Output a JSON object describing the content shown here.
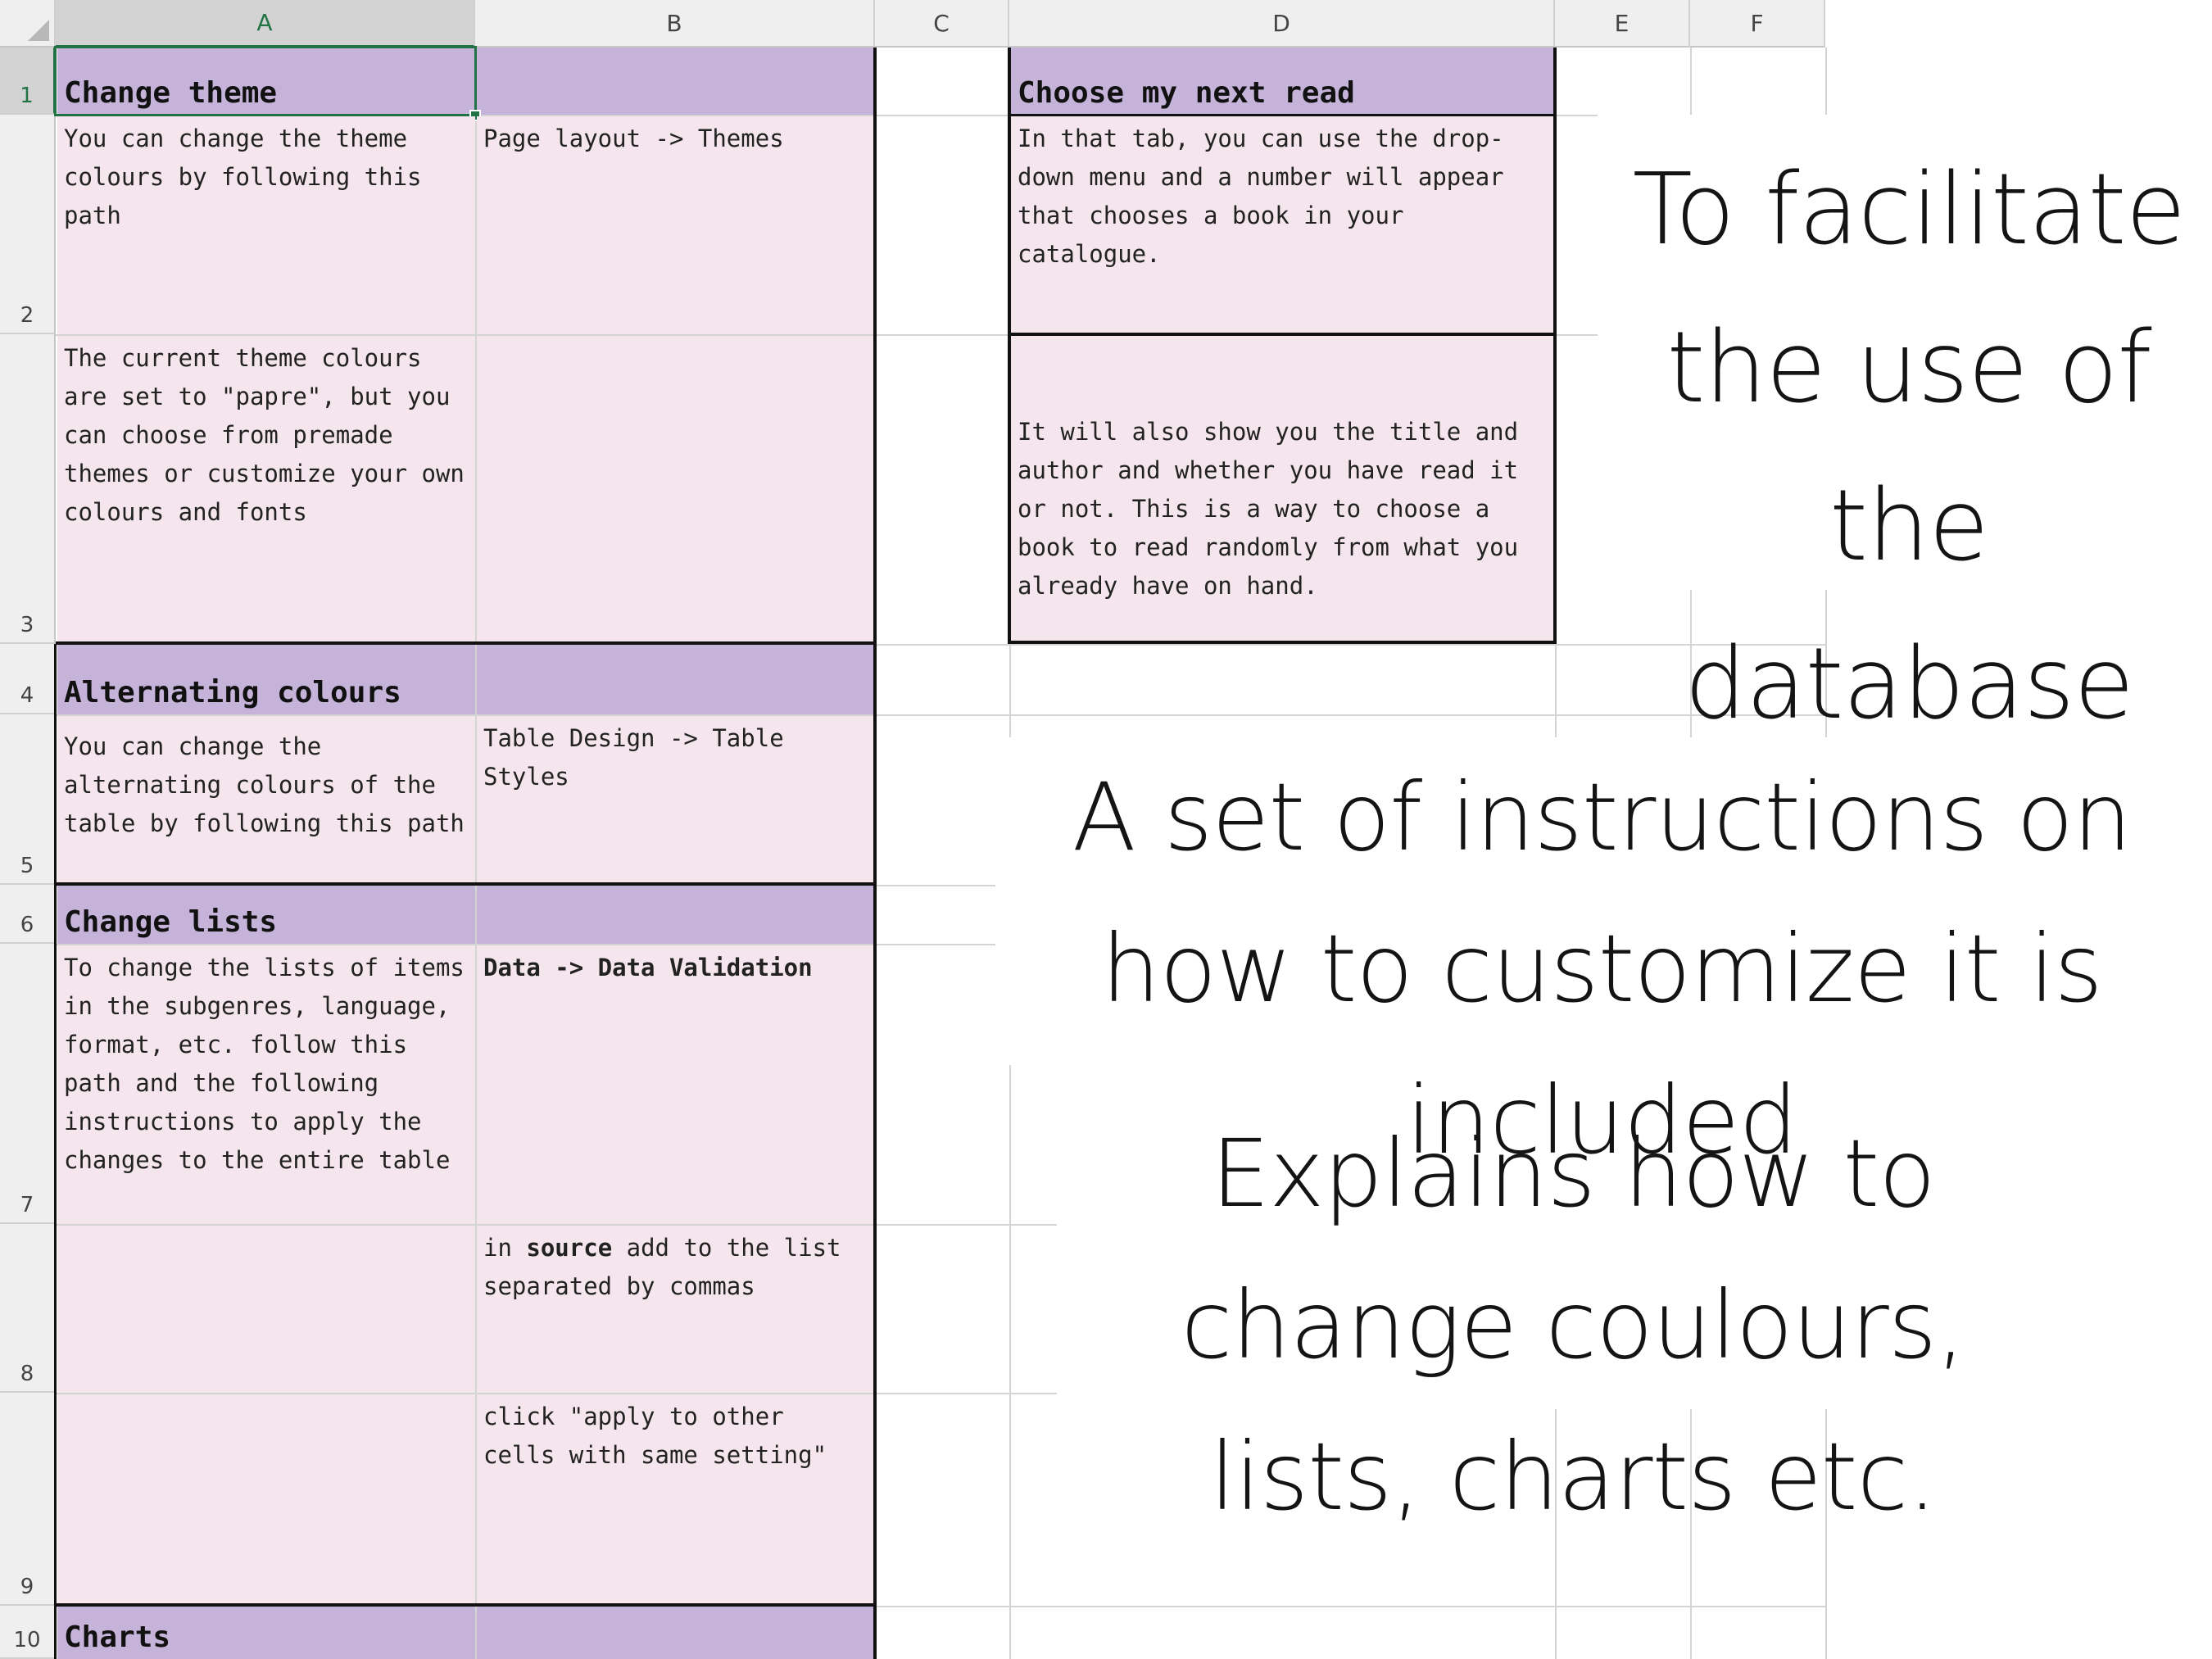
{
  "columns": [
    "A",
    "B",
    "C",
    "D",
    "E",
    "F"
  ],
  "rows": [
    "1",
    "2",
    "3",
    "4",
    "5",
    "6",
    "7",
    "8",
    "9",
    "10"
  ],
  "cells": {
    "A1": "Change theme",
    "D1": "Choose my next read",
    "A2": "You can change the theme colours by following this path",
    "B2": "Page layout -> Themes",
    "D2": "In that tab, you can use the drop-down menu and a number will appear that chooses a book in your catalogue.",
    "A3": "The current theme colours are set to \"papre\", but you can choose from premade themes or customize your own colours and fonts",
    "D3": "It will also show you the title and author and whether you have read it or not. This is a way to choose a book to read randomly from what you already have on hand.",
    "A4": "Alternating colours",
    "A5": "You can change the alternating colours of the table by following this path",
    "B5": "Table Design -> Table Styles",
    "A6": "Change lists",
    "A7": "To change the lists of items in the subgenres, language, format, etc. follow this path and the following instructions to apply the changes to the entire table",
    "B7": "Data -> Data Validation",
    "B8_pre": "in ",
    "B8_bold": "source",
    "B8_post": " add to the list separated by commas",
    "B9": "click \"apply to other cells with same setting\"",
    "A10": "Charts"
  },
  "overlay": {
    "text1": "To facilitate the use of the database",
    "text2": "A set of instructions on how to customize it is included",
    "text3": "Explains how to change coulours, lists, charts etc."
  },
  "colors": {
    "header_purple": "#c5b3d9",
    "body_pink": "#f4e6ec",
    "excel_green": "#217346"
  }
}
